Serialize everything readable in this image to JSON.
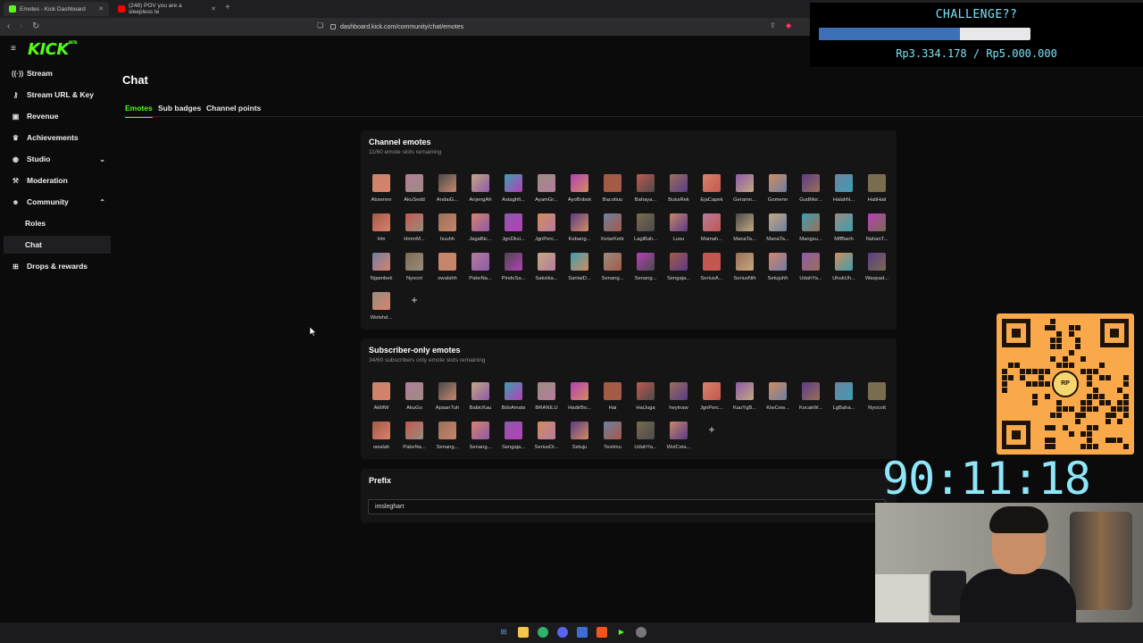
{
  "browser": {
    "tabs": [
      {
        "title": "Emotes - Kick Dashboard",
        "color": "#53fc18",
        "active": true
      },
      {
        "title": "(248) POV you are a sleepless te",
        "color": "#ff0000",
        "active": false
      }
    ],
    "url": "dashboard.kick.com/community/chat/emotes"
  },
  "sidebar": {
    "logo": "KICK",
    "logo_badge": "BETA",
    "items": [
      {
        "label": "Stream",
        "icon": "broadcast-icon"
      },
      {
        "label": "Stream URL & Key",
        "icon": "key-icon"
      },
      {
        "label": "Revenue",
        "icon": "wallet-icon"
      },
      {
        "label": "Achievements",
        "icon": "trophy-icon"
      },
      {
        "label": "Studio",
        "icon": "studio-icon",
        "chevron": "down"
      },
      {
        "label": "Moderation",
        "icon": "hammer-icon"
      },
      {
        "label": "Community",
        "icon": "people-icon",
        "chevron": "up"
      },
      {
        "label": "Drops & rewards",
        "icon": "gift-icon"
      }
    ],
    "community_sub": [
      "Roles",
      "Chat"
    ],
    "selected": "Chat"
  },
  "main": {
    "title": "Chat",
    "tabs": [
      "Emotes",
      "Sub badges",
      "Channel points"
    ],
    "active_tab": "Emotes",
    "channel_emotes": {
      "title": "Channel emotes",
      "subtitle": "11/60 emote slots remaining",
      "names": [
        "Absennn",
        "AkuSedd",
        "AndaiG...",
        "AnjengAh",
        "Astaghfi...",
        "AyamGr...",
        "AyoBobok",
        "Bacotiuu",
        "Bahaya...",
        "BukaRek",
        "EjaCapek",
        "Geramn...",
        "Gomenn",
        "GudMor...",
        "HalahN...",
        "HatiHati",
        "Hm",
        "HmmM...",
        "huuhh",
        "JagaBic...",
        "JgnDksi...",
        "JgnPerc...",
        "Kebang...",
        "KetarKetir",
        "LagiBah...",
        "Luxu",
        "Mamah...",
        "ManaTa...",
        "ManaTa...",
        "Mangsu...",
        "MffBanh",
        "NahanT...",
        "Ngambek",
        "Nyocot",
        "owalahh",
        "PakeNa...",
        "PindoSa...",
        "Saksika...",
        "SantaiD...",
        "Senang...",
        "Senang...",
        "Sengaja...",
        "SeriusA...",
        "SeriusNih",
        "Setujuhh",
        "UdahYa...",
        "UhukUh...",
        "Waspad...",
        "Welehd..."
      ],
      "add_label": "+"
    },
    "sub_emotes": {
      "title": "Subscriber-only emotes",
      "subtitle": "34/60 subscribers only emote slots remaining",
      "names": [
        "AkMW",
        "AkuGo",
        "ApaanTuh",
        "BabicKau",
        "BdoAmats",
        "BRANILU",
        "HadirBo...",
        "Hai",
        "HaiJuga",
        "heyinaw",
        "JgnPerc...",
        "KauYgB...",
        "KiwCew...",
        "KocakW...",
        "LgBaha...",
        "Nyocott",
        "owalah",
        "PakeNa...",
        "Senang...",
        "Senang...",
        "Sengaja...",
        "SeriusDi...",
        "Setuju",
        "Tesiimu",
        "UdahYa...",
        "WolCeia..."
      ],
      "add_label": "+"
    },
    "prefix": {
      "title": "Prefix",
      "value": "imsleghart"
    }
  },
  "overlay": {
    "challenge_title": "CHALLENGE??",
    "challenge_amount": "Rp3.334.178 / Rp5.000.000",
    "challenge_progress": 0.667,
    "timer": "90:11:18",
    "qr_label": "RP"
  },
  "colors": {
    "kick_green": "#53fc18",
    "emote_palette": [
      "#c7866a",
      "#5b3b86",
      "#d9826b",
      "#a35a47",
      "#3d9fb0",
      "#b67c9c",
      "#6f7fa3",
      "#8e5aa8",
      "#c2584f",
      "#9a8c80",
      "#4a4a4a",
      "#7a6c4e",
      "#d28c5e",
      "#9a6f5a",
      "#b63fb8",
      "#c4a882"
    ]
  }
}
